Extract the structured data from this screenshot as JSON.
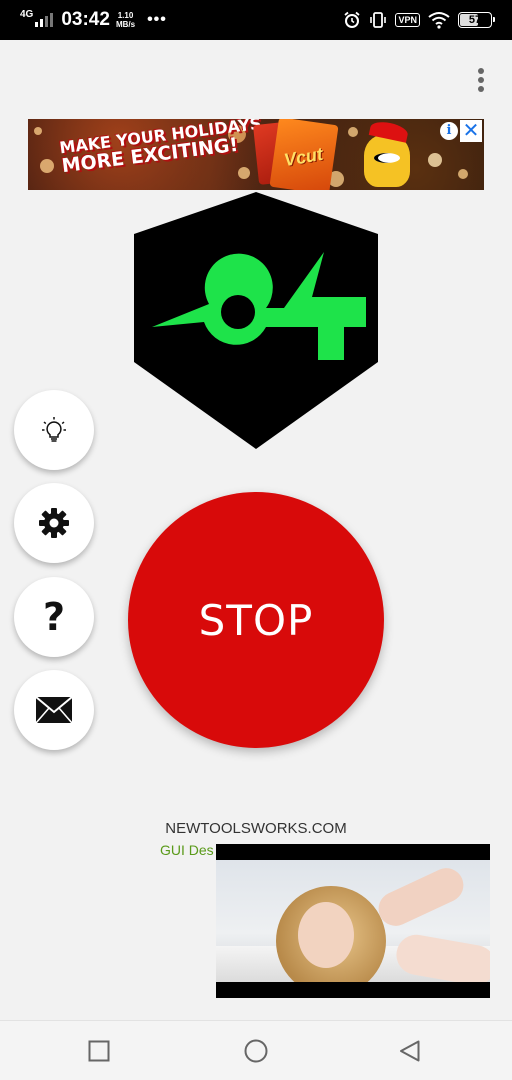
{
  "status_bar": {
    "network": "4G",
    "time": "03:42",
    "speed_value": "1.10",
    "speed_unit": "MB/s",
    "notifications_more": "•••",
    "vpn": "VPN",
    "battery_level": "57",
    "icons": [
      "signal-icon",
      "alarm-icon",
      "vibrate-icon",
      "vpn-icon",
      "wifi-icon",
      "battery-icon"
    ]
  },
  "header": {
    "overflow_menu_icon": "more-vert-icon"
  },
  "ad_banner": {
    "headline_line1": "MAKE YOUR HOLIDAYS",
    "headline_line2": "MORE EXCITING!",
    "brand": "Vcut",
    "info_glyph": "i",
    "close_glyph": "✕"
  },
  "logo": {
    "shape": "black hexagon with green whistle",
    "colors": {
      "background": "#000000",
      "mark": "#1ee34a"
    }
  },
  "side_buttons": [
    {
      "id": "tips",
      "icon": "lightbulb-icon"
    },
    {
      "id": "settings",
      "icon": "gear-icon"
    },
    {
      "id": "help",
      "icon": "question-icon",
      "glyph": "?"
    },
    {
      "id": "contact",
      "icon": "envelope-icon"
    }
  ],
  "main": {
    "stop_label": "STOP",
    "stop_color": "#d80a0a"
  },
  "footer": {
    "site": "NEWTOOLSWORKS.COM",
    "credit_partial": "GUI Des"
  },
  "video_ad": {
    "icon": "video-ad-thumbnail"
  },
  "nav_bar": {
    "buttons": [
      "recents-square-icon",
      "home-circle-icon",
      "back-triangle-icon"
    ]
  }
}
